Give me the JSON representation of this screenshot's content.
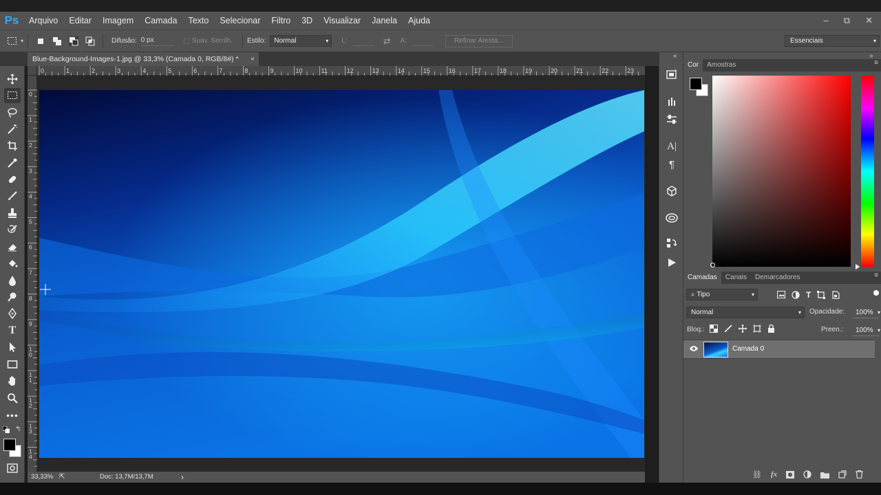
{
  "app": {
    "logo": "Ps"
  },
  "menu": [
    "Arquivo",
    "Editar",
    "Imagem",
    "Camada",
    "Texto",
    "Selecionar",
    "Filtro",
    "3D",
    "Visualizar",
    "Janela",
    "Ajuda"
  ],
  "window_controls": {
    "minimize": "–",
    "restore": "⧉",
    "close": "✕"
  },
  "options": {
    "feather_label": "Difusão:",
    "feather_value": "0 px",
    "antialias_label": "Suav. Serrilh.",
    "style_label": "Estilo:",
    "style_value": "Normal",
    "width_label": "L:",
    "height_label": "A:",
    "refine_label": "Refinar Aresta...",
    "workspace": "Essenciais"
  },
  "document": {
    "tab_title": "Blue-Background-Images-1.jpg @ 33,3% (Camada 0, RGB/8#) *",
    "close": "×"
  },
  "ruler_top": [
    "0",
    "1",
    "2",
    "3",
    "4",
    "5",
    "6",
    "7",
    "8",
    "9",
    "10",
    "11",
    "12",
    "13",
    "14",
    "15",
    "16",
    "17",
    "18",
    "19",
    "20",
    "21",
    "22",
    "23"
  ],
  "ruler_left": [
    "0",
    "1",
    "2",
    "3",
    "4",
    "5",
    "6",
    "7",
    "8",
    "9",
    "1\n0",
    "1\n1",
    "1\n2",
    "1\n3",
    "1\n4"
  ],
  "status": {
    "zoom": "33,33%",
    "doc": "Doc: 13,7M/13,7M",
    "arrow": "›"
  },
  "color_panel": {
    "tabs": [
      "Cor",
      "Amostras"
    ],
    "hue_marker_fraction": 0.0
  },
  "layers_panel": {
    "tabs": [
      "Camadas",
      "Canais",
      "Demarcadores"
    ],
    "filter_kind": "Tipo",
    "blend_mode": "Normal",
    "opacity_label": "Opacidade:",
    "opacity_value": "100%",
    "lock_label": "Bloq.:",
    "fill_label": "Preen.:",
    "fill_value": "100%",
    "layers": [
      {
        "name": "Camada 0",
        "visible": true
      }
    ]
  },
  "colors": {
    "accent": "#31a8ff",
    "ui_bg": "#535353",
    "canvas_bg": "#282828"
  }
}
